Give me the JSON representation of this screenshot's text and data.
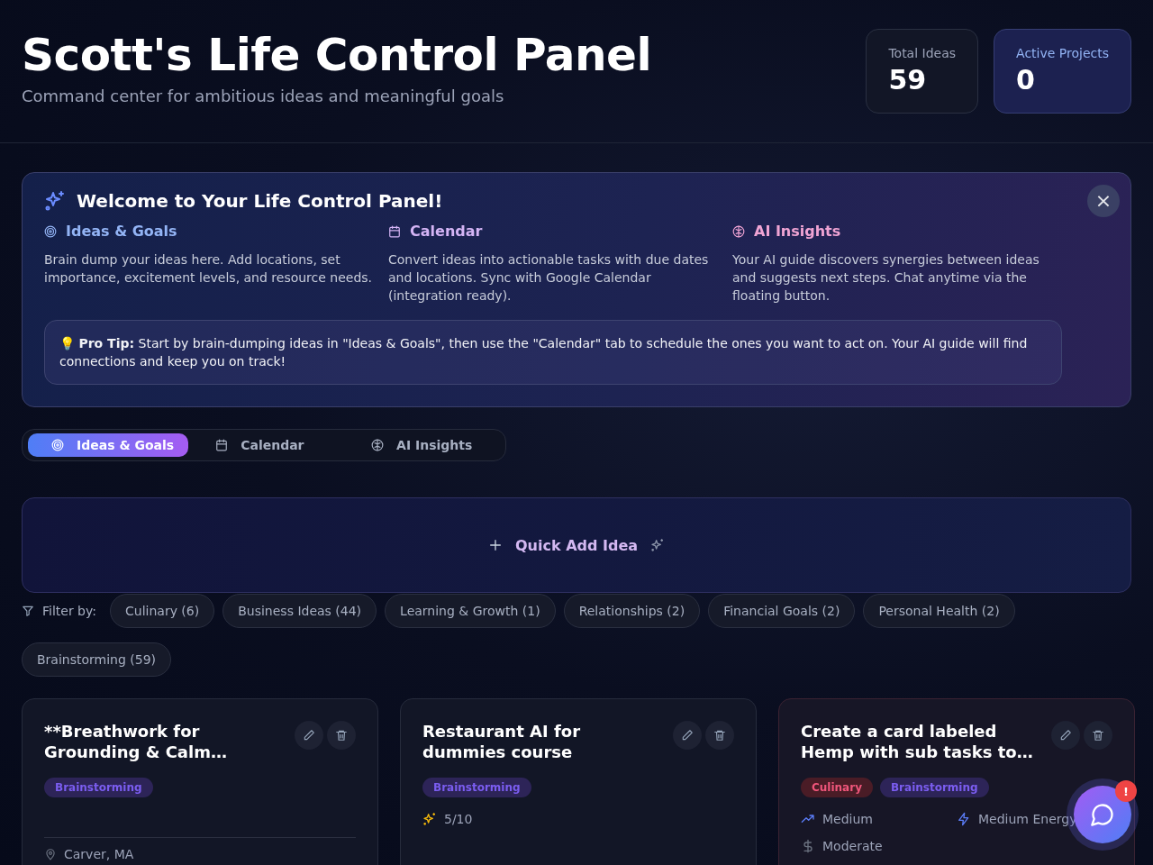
{
  "header": {
    "title": "Scott's Life Control Panel",
    "subtitle": "Command center for ambitious ideas and meaningful goals"
  },
  "stats": [
    {
      "label": "Total Ideas",
      "value": "59",
      "highlighted": false
    },
    {
      "label": "Active Projects",
      "value": "0",
      "highlighted": true
    }
  ],
  "welcome": {
    "title": "Welcome to Your Life Control Panel!",
    "close": "×",
    "sections": [
      {
        "kind": "target",
        "title": "Ideas & Goals",
        "color": "#93b4f5",
        "text": "Brain dump your ideas here. Add locations, set importance, excitement levels, and resource needs."
      },
      {
        "kind": "calendar",
        "title": "Calendar",
        "color": "#d4b4f5",
        "text": "Convert ideas into actionable tasks with due dates and locations. Sync with Google Calendar (integration ready)."
      },
      {
        "kind": "brain",
        "title": "AI Insights",
        "color": "#f0a4d4",
        "text": "Your AI guide discovers synergies between ideas and suggests next steps. Chat anytime via the floating button."
      }
    ],
    "tip": "💡 **Pro Tip:** Start by brain-dumping ideas in \"Ideas & Goals\", then use the \"Calendar\" tab to schedule the ones you want to act on. Your AI guide will find connections and keep you on track!"
  },
  "tabs": [
    {
      "kind": "target",
      "label": "Ideas & Goals",
      "selected": true
    },
    {
      "kind": "calendar",
      "label": "Calendar",
      "selected": false
    },
    {
      "kind": "brain",
      "label": "AI Insights",
      "selected": false
    }
  ],
  "quick_add": {
    "label": "Quick Add Idea"
  },
  "filter": {
    "label": "Filter by:",
    "chips": [
      "Culinary (6)",
      "Business Ideas (44)",
      "Learning & Growth (1)",
      "Relationships (2)",
      "Financial Goals (2)",
      "Personal Health (2)",
      "Brainstorming (59)"
    ]
  },
  "cards": [
    {
      "title": "**Breathwork for Grounding & Calm…",
      "accent": false,
      "tags": [
        {
          "label": "Brainstorming",
          "color": "#2d2458"
        }
      ],
      "meta": [
        {
          "kind": "location",
          "text": "Carver, MA"
        }
      ]
    },
    {
      "title": "Restaurant AI for dummies course",
      "accent": false,
      "tags": [
        {
          "label": "Brainstorming",
          "color": "#2d2458"
        }
      ],
      "meta": [
        {
          "kind": "excitement",
          "text": "5/10"
        }
      ]
    },
    {
      "title": "Create a card labeled Hemp with sub tasks to…",
      "accent": true,
      "tags": [
        {
          "label": "Culinary",
          "color": "#4a1c26"
        },
        {
          "label": "Brainstorming",
          "color": "#2d2458"
        }
      ],
      "meta": [
        {
          "kind": "importance",
          "text": "Medium"
        },
        {
          "kind": "energy",
          "text": "Medium Energy"
        },
        {
          "kind": "cost",
          "text": "Moderate"
        }
      ]
    }
  ],
  "chat": {
    "badge": "!"
  }
}
